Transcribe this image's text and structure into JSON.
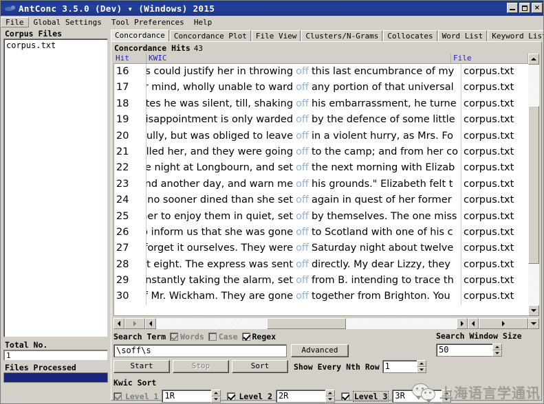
{
  "window": {
    "title": "AntConc 3.5.0 (Dev) ▾ (Windows) 2015",
    "icon": "antconc-ant-icon",
    "minimize_label": "Minimize",
    "maximize_label": "Maximize",
    "close_label": "×"
  },
  "menubar": {
    "items": [
      {
        "label": "File"
      },
      {
        "label": "Global Settings"
      },
      {
        "label": "Tool Preferences"
      },
      {
        "label": "Help"
      }
    ]
  },
  "sidebar": {
    "corpus_files_label": "Corpus Files",
    "files": [
      "corpus.txt"
    ],
    "total_no_label": "Total No.",
    "total_no_value": "1",
    "files_processed_label": "Files Processed",
    "progress_percent": 100,
    "progress_color": "#18267a"
  },
  "tabs": [
    {
      "label": "Concordance",
      "active": true
    },
    {
      "label": "Concordance Plot",
      "active": false
    },
    {
      "label": "File View",
      "active": false
    },
    {
      "label": "Clusters/N-Grams",
      "active": false
    },
    {
      "label": "Collocates",
      "active": false
    },
    {
      "label": "Word List",
      "active": false
    },
    {
      "label": "Keyword List",
      "active": false
    }
  ],
  "concordance": {
    "hits_label": "Concordance Hits",
    "hits_count": "43",
    "columns": {
      "hit": "Hit",
      "kwic": "KWIC",
      "file": "File"
    },
    "header_color": "#2222cc",
    "node_color": "#8fb3d9",
    "rows": [
      {
        "hit": "16",
        "left": "ties could justify her in throwing",
        "node": "off",
        "right": "this last encumbrance of my",
        "file": "corpus.txt"
      },
      {
        "hit": "17",
        "left": "her mind, wholly unable to ward",
        "node": "off",
        "right": "any portion of that universal",
        "file": "corpus.txt"
      },
      {
        "hit": "18",
        "left": "inutes he was silent, till, shaking",
        "node": "off",
        "right": "his embarrassment, he turne",
        "file": "corpus.txt"
      },
      {
        "hit": "19",
        "left": "l disappointment is only warded",
        "node": "off",
        "right": "by the defence of some little",
        "file": "corpus.txt"
      },
      {
        "hit": "20",
        "left": "re fully, but was obliged to leave",
        "node": "off",
        "right": "in a violent hurry, as Mrs. Fo",
        "file": "corpus.txt"
      },
      {
        "hit": "21",
        "left": "r called her, and they were going",
        "node": "off",
        "right": "to the camp; and from her co",
        "file": "corpus.txt"
      },
      {
        "hit": "22",
        "left": "one night at Longbourn, and set",
        "node": "off",
        "right": "the next morning with Elizab",
        "file": "corpus.txt"
      },
      {
        "hit": "23",
        "left": "mind another day, and warn me",
        "node": "off",
        "right": "his grounds.\"  Elizabeth felt t",
        "file": "corpus.txt"
      },
      {
        "hit": "24",
        "left": "ad no sooner dined than she set",
        "node": "off",
        "right": "again in quest of her former",
        "file": "corpus.txt"
      },
      {
        "hit": "25",
        "left": "g her to enjoy them in quiet, set",
        "node": "off",
        "right": "by themselves. The one miss",
        "file": "corpus.txt"
      },
      {
        "hit": "26",
        "left": ", to inform us that she was gone",
        "node": "off",
        "right": "to Scotland with one of his c",
        "file": "corpus.txt"
      },
      {
        "hit": "27",
        "left": "st forget it ourselves. They were",
        "node": "off",
        "right": "Saturday night about twelve",
        "file": "corpus.txt"
      },
      {
        "hit": "28",
        "left": "g at eight. The express was sent",
        "node": "off",
        "right": "directly. My dear Lizzy, they",
        "file": "corpus.txt"
      },
      {
        "hit": "29",
        "left": "o, instantly taking the alarm, set",
        "node": "off",
        "right": "from B. intending to trace th",
        "file": "corpus.txt"
      },
      {
        "hit": "30",
        "left": "-of Mr. Wickham. They are gone",
        "node": "off",
        "right": "together from Brighton. You",
        "file": "corpus.txt"
      }
    ]
  },
  "search": {
    "search_term_label": "Search Term",
    "words_label": "Words",
    "words_checked": true,
    "words_enabled": false,
    "case_label": "Case",
    "case_checked": false,
    "case_enabled": false,
    "regex_label": "Regex",
    "regex_checked": true,
    "regex_enabled": true,
    "search_value": "\\soff\\s",
    "search_placeholder": "",
    "advanced_label": "Advanced",
    "start_label": "Start",
    "stop_label": "Stop",
    "stop_enabled": false,
    "sort_label": "Sort",
    "show_every_nth_label": "Show Every Nth Row",
    "show_every_nth_value": "1",
    "search_window_size_label": "Search Window Size",
    "search_window_size_value": "50"
  },
  "kwic_sort": {
    "title": "Kwic Sort",
    "levels": [
      {
        "label": "Level 1",
        "value": "1R",
        "checked": true,
        "enabled": false
      },
      {
        "label": "Level 2",
        "value": "2R",
        "checked": true,
        "enabled": true
      },
      {
        "label": "Level 3",
        "value": "3R",
        "checked": true,
        "enabled": true
      }
    ]
  },
  "watermark": {
    "text": "上海语言学通讯",
    "icon": "wechat-icon"
  }
}
